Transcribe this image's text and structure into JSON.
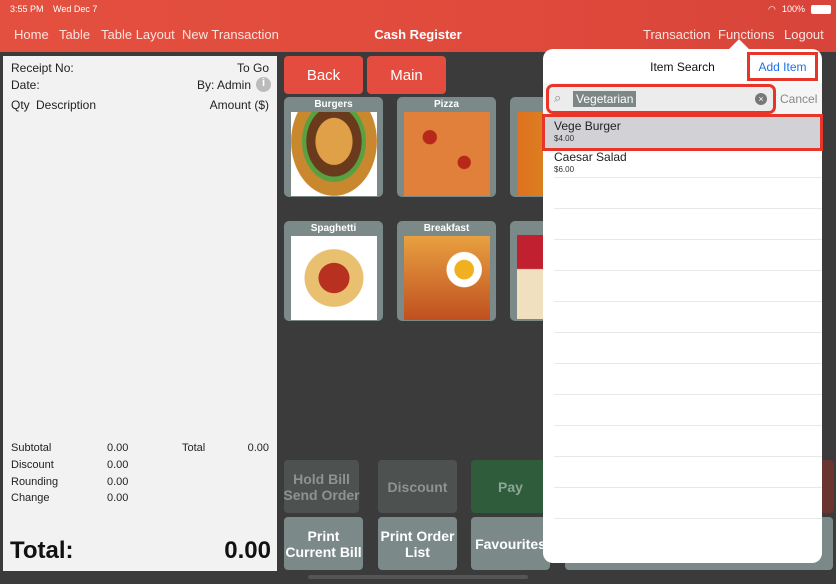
{
  "status": {
    "time": "3:55 PM",
    "date": "Wed Dec 7",
    "battery": "100%"
  },
  "nav": {
    "left": [
      "Home",
      "Table",
      "Table Layout",
      "New Transaction"
    ],
    "title": "Cash Register",
    "right": [
      "Transaction",
      "Functions",
      "Logout"
    ]
  },
  "receipt": {
    "receipt_no": "Receipt No:",
    "order_type": "To Go",
    "date": "Date:",
    "by": "By: Admin",
    "qty": "Qty",
    "description": "Description",
    "amount": "Amount ($)",
    "subtotal_label": "Subtotal",
    "subtotal": "0.00",
    "total_label": "Total",
    "total_small": "0.00",
    "discount_label": "Discount",
    "discount": "0.00",
    "rounding_label": "Rounding",
    "rounding": "0.00",
    "change_label": "Change",
    "change": "0.00",
    "grand_label": "Total:",
    "grand": "0.00"
  },
  "buttons": {
    "back": "Back",
    "main": "Main",
    "hold": "Hold Bill\nSend Order",
    "discount": "Discount",
    "pay": "Pay",
    "print_bill": "Print\nCurrent Bill",
    "print_order": "Print Order\nList",
    "favourites": "Favourites"
  },
  "categories": [
    "Burgers",
    "Pizza",
    "Co",
    "Spaghetti",
    "Breakfast",
    ""
  ],
  "search": {
    "title": "Item Search",
    "add": "Add Item",
    "query": "Vegetarian",
    "cancel": "Cancel",
    "results": [
      {
        "name": "Vege Burger",
        "price": "$4.00",
        "selected": true
      },
      {
        "name": "Caesar Salad",
        "price": "$6.00",
        "selected": false
      }
    ]
  },
  "colors": {
    "accent": "#e44c3f",
    "link": "#1a73e8",
    "pay": "#2f5d3c"
  }
}
